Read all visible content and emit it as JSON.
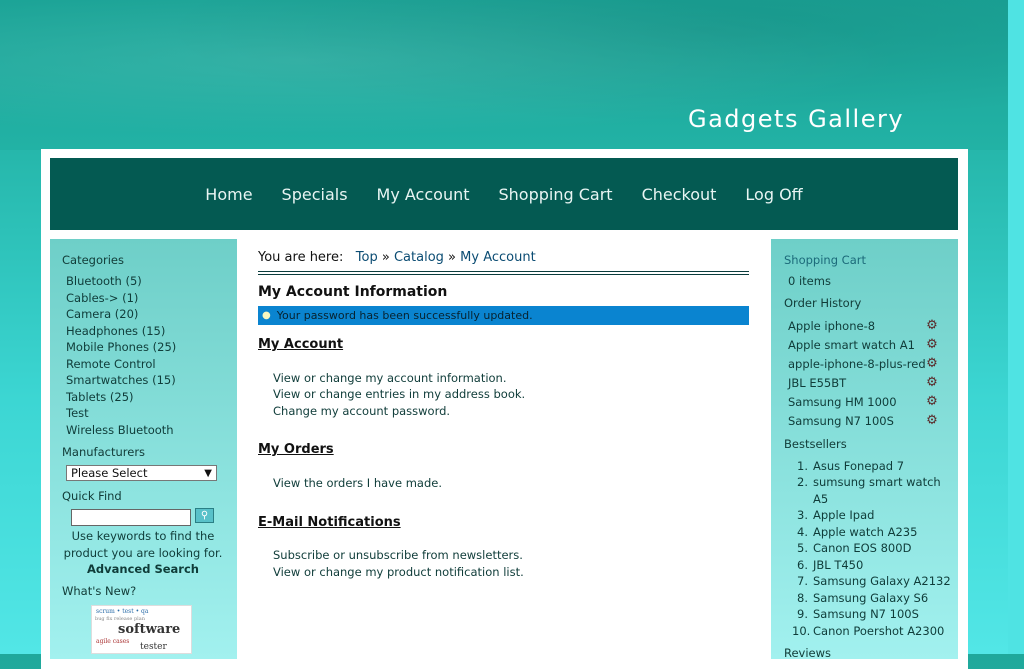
{
  "site": {
    "title": "Gadgets Gallery"
  },
  "nav": [
    "Home",
    "Specials",
    "My Account",
    "Shopping Cart",
    "Checkout",
    "Log Off"
  ],
  "left": {
    "categories_title": "Categories",
    "categories": [
      "Bluetooth (5)",
      "Cables-> (1)",
      "Camera (20)",
      "Headphones (15)",
      "Mobile Phones (25)",
      "Remote Control",
      "Smartwatches (15)",
      "Tablets (25)",
      "Test",
      "Wireless Bluetooth"
    ],
    "manufacturers_title": "Manufacturers",
    "manufacturers_selected": "Please Select",
    "quickfind_title": "Quick Find",
    "quickfind_help": "Use keywords to find the product you are looking for.",
    "advanced_search": "Advanced Search",
    "whats_new_title": "What's New?",
    "whats_new_image_words": [
      "software",
      "tester"
    ]
  },
  "breadcrumb": {
    "prefix": "You are here:",
    "items": [
      "Top",
      "Catalog",
      "My Account"
    ],
    "separator": "»"
  },
  "main": {
    "heading": "My Account Information",
    "message": "Your password has been successfully updated.",
    "my_account_title": "My Account",
    "my_account_links": [
      "View or change my account information.",
      "View or change entries in my address book.",
      "Change my account password."
    ],
    "my_orders_title": "My Orders",
    "my_orders_links": [
      "View the orders I have made."
    ],
    "email_title": "E-Mail Notifications",
    "email_links": [
      "Subscribe or unsubscribe from newsletters.",
      "View or change my product notification list."
    ]
  },
  "right": {
    "cart_title": "Shopping Cart",
    "cart_items": "0 items",
    "order_history_title": "Order History",
    "order_history": [
      "Apple iphone-8",
      "Apple smart watch A1",
      "apple-iphone-8-plus-red",
      "JBL E55BT",
      "Samsung HM 1000",
      "Samsung N7 100S"
    ],
    "bestsellers_title": "Bestsellers",
    "bestsellers": [
      {
        "num": "1.",
        "name": "Asus Fonepad 7"
      },
      {
        "num": "2.",
        "name": "sumsung smart watch"
      },
      {
        "num": "",
        "name": "A5"
      },
      {
        "num": "3.",
        "name": "Apple Ipad"
      },
      {
        "num": "4.",
        "name": "Apple watch A235"
      },
      {
        "num": "5.",
        "name": "Canon EOS 800D"
      },
      {
        "num": "6.",
        "name": "JBL T450"
      },
      {
        "num": "7.",
        "name": "Samsung Galaxy A2132"
      },
      {
        "num": "8.",
        "name": "Samsung Galaxy S6"
      },
      {
        "num": "9.",
        "name": "Samsung N7 100S"
      },
      {
        "num": "10.",
        "name": "Canon Poershot A2300"
      }
    ],
    "reviews_title": "Reviews"
  }
}
